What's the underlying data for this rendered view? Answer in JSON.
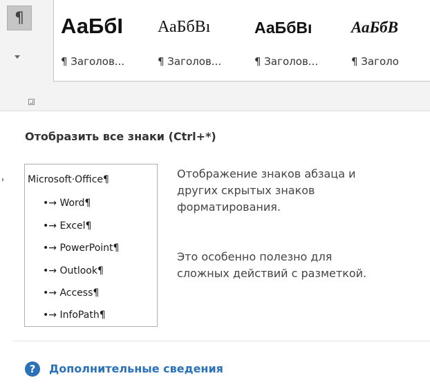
{
  "ribbon": {
    "show_marks_glyph": "¶",
    "dropdown_icon": "chevron-down-icon",
    "launcher_icon": "dialog-launcher-icon"
  },
  "styles_gallery": {
    "items": [
      {
        "sample": "АаБбI",
        "name": "¶ Заголов..."
      },
      {
        "sample": "АаБбВı",
        "name": "¶ Заголов..."
      },
      {
        "sample": "АаБбВı",
        "name": "¶ Заголов..."
      },
      {
        "sample": "АаБбВ",
        "name": "¶ Заголо"
      }
    ]
  },
  "tooltip": {
    "title": "Отобразить все знаки (Ctrl+*)",
    "preview": {
      "header": "Microsoft·Office¶",
      "items": [
        "•→ Word¶",
        "•→ Excel¶",
        "•→ PowerPoint¶",
        "•→ Outlook¶",
        "•→ Access¶",
        "•→ InfoPath¶"
      ]
    },
    "description_lines": [
      "Отображение знаков абзаца и",
      "других скрытых знаков",
      "форматирования."
    ],
    "note_lines": [
      "Это особенно полезно для",
      "сложных действий с разметкой."
    ],
    "help_icon": "help-icon",
    "help_glyph": "?",
    "help_link": "Дополнительные сведения",
    "accent_color": "#2b71b8"
  }
}
